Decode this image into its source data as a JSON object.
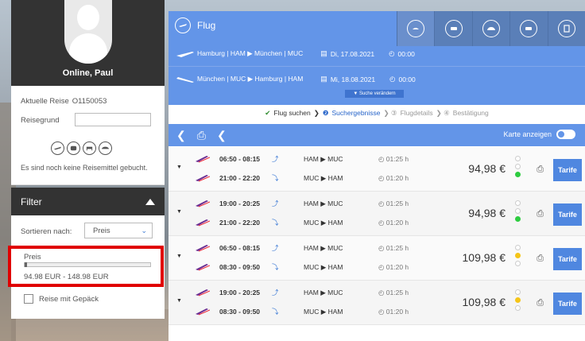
{
  "profile": {
    "name": "Online, Paul"
  },
  "trip": {
    "current_label": "Aktuelle Reise",
    "current_value": "O1150053",
    "reason_label": "Reisegrund",
    "reason_value": "",
    "no_travel_text": "Es sind noch keine Reisemittel gebucht.",
    "mode_icons": [
      "plane-icon",
      "train-icon",
      "hotel-icon",
      "car-icon"
    ]
  },
  "filter": {
    "title": "Filter",
    "sort_label": "Sortieren nach:",
    "sort_value": "Preis",
    "price_label": "Preis",
    "price_range": "94.98 EUR - 148.98 EUR",
    "luggage_label": "Reise mit Gepäck"
  },
  "header": {
    "title": "Flug",
    "tabs": [
      "plane-icon",
      "train-icon",
      "hotel-icon",
      "taxi-icon",
      "clipboard-icon"
    ],
    "outbound": {
      "route": "Hamburg | HAM ▶ München | MUC",
      "date": "Di, 17.08.2021",
      "time": "00:00"
    },
    "return": {
      "route": "München | MUC ▶ Hamburg | HAM",
      "date": "Mi, 18.08.2021",
      "time": "00:00"
    },
    "change_search": "▼ Suche verändern"
  },
  "steps": {
    "s1": "Flug suchen",
    "s2": "Suchergebnisse",
    "s3": "Flugdetails",
    "s4": "Bestätigung"
  },
  "toolbar": {
    "map_label": "Karte anzeigen"
  },
  "results": [
    {
      "out": {
        "time": "06:50 - 08:15",
        "route": "HAM ▶ MUC",
        "duration": "01:25 h"
      },
      "ret": {
        "time": "21:00 - 22:20",
        "route": "MUC ▶ HAM",
        "duration": "01:20 h"
      },
      "price": "94,98 €",
      "status": "green",
      "button": "Tarife"
    },
    {
      "out": {
        "time": "19:00 - 20:25",
        "route": "HAM ▶ MUC",
        "duration": "01:25 h"
      },
      "ret": {
        "time": "21:00 - 22:20",
        "route": "MUC ▶ HAM",
        "duration": "01:20 h"
      },
      "price": "94,98 €",
      "status": "green",
      "button": "Tarife"
    },
    {
      "out": {
        "time": "06:50 - 08:15",
        "route": "HAM ▶ MUC",
        "duration": "01:25 h"
      },
      "ret": {
        "time": "08:30 - 09:50",
        "route": "MUC ▶ HAM",
        "duration": "01:20 h"
      },
      "price": "109,98 €",
      "status": "yellow",
      "button": "Tarife"
    },
    {
      "out": {
        "time": "19:00 - 20:25",
        "route": "HAM ▶ MUC",
        "duration": "01:25 h"
      },
      "ret": {
        "time": "08:30 - 09:50",
        "route": "MUC ▶ HAM",
        "duration": "01:20 h"
      },
      "price": "109,98 €",
      "status": "yellow",
      "button": "Tarife"
    }
  ],
  "colors": {
    "accent": "#6395e8",
    "button": "#4f87e0",
    "dark": "#333333",
    "highlight": "#e00000"
  }
}
